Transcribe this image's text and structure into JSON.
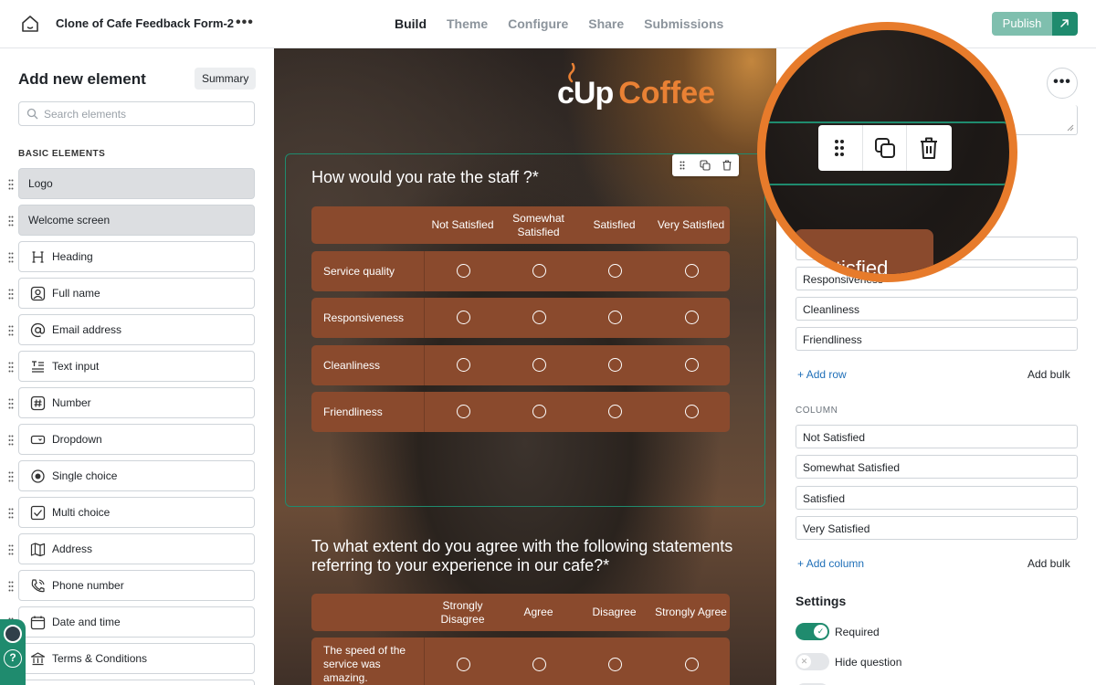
{
  "topbar": {
    "form_title": "Clone of Cafe Feedback Form-2",
    "more": "•••",
    "tabs": [
      "Build",
      "Theme",
      "Configure",
      "Share",
      "Submissions"
    ],
    "active_tab": "Build",
    "publish_label": "Publish"
  },
  "left": {
    "title": "Add new element",
    "summary_label": "Summary",
    "search_placeholder": "Search elements",
    "section_label": "BASIC ELEMENTS",
    "elements": [
      "Logo",
      "Welcome screen",
      "Heading",
      "Full name",
      "Email address",
      "Text input",
      "Number",
      "Dropdown",
      "Single choice",
      "Multi choice",
      "Address",
      "Phone number",
      "Date and time",
      "Terms & Conditions"
    ],
    "help_label": "?"
  },
  "preview": {
    "logo_cup": "cUp",
    "logo_coffee": "Coffee",
    "question1": {
      "title": "How would you rate the staff ?*",
      "columns": [
        "Not Satisfied",
        "Somewhat Satisfied",
        "Satisfied",
        "Very Satisfied"
      ],
      "rows": [
        "Service quality",
        "Responsiveness",
        "Cleanliness",
        "Friendliness"
      ]
    },
    "question2": {
      "title": "To what extent do you agree with the following statements referring to your experience in our cafe?*",
      "columns": [
        "Strongly Disagree",
        "Agree",
        "Disagree",
        "Strongly Agree"
      ],
      "rows": [
        "The speed of the service was amazing."
      ]
    }
  },
  "right": {
    "more": "•••",
    "rows": [
      "Responsiveness",
      "Cleanliness",
      "Friendliness"
    ],
    "add_row": "Add row",
    "add_bulk": "Add bulk",
    "column_label": "COLUMN",
    "columns": [
      "Not Satisfied",
      "Somewhat Satisfied",
      "Satisfied",
      "Very Satisfied"
    ],
    "add_column": "Add column",
    "settings_title": "Settings",
    "required_label": "Required",
    "hide_label": "Hide question",
    "required_on": true,
    "hide_on": false
  },
  "zoom": {
    "card_text": "Satisfied"
  },
  "colors": {
    "brand": "#1f8b6e",
    "accent_orange": "#e77b2b",
    "matrix_brown": "#8a4a2d",
    "link": "#1f6fb8"
  }
}
